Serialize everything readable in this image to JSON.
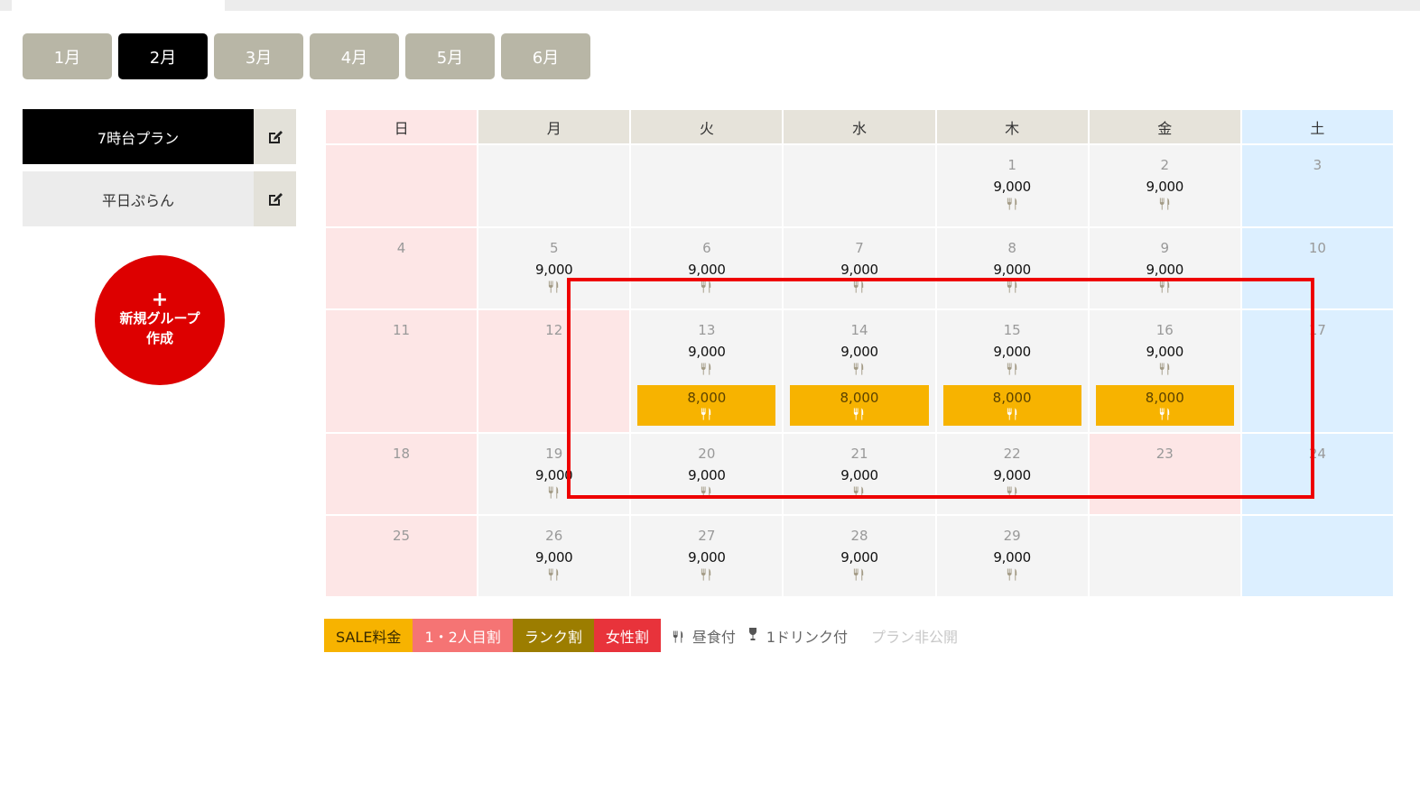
{
  "month_tabs": [
    {
      "label": "1月"
    },
    {
      "label": "2月"
    },
    {
      "label": "3月"
    },
    {
      "label": "4月"
    },
    {
      "label": "5月"
    },
    {
      "label": "6月"
    }
  ],
  "active_month": "2月",
  "plans": [
    {
      "name": "7時台プラン",
      "active": true
    },
    {
      "name": "平日ぷらん",
      "active": false
    }
  ],
  "new_group": {
    "plus": "+",
    "line1": "新規グループ",
    "line2": "作成"
  },
  "calendar": {
    "weekdays": [
      "日",
      "月",
      "火",
      "水",
      "木",
      "金",
      "土"
    ],
    "weeks": [
      [
        {
          "type": "sun",
          "day": "",
          "price": "",
          "meal": false
        },
        {
          "type": "",
          "day": "",
          "price": "",
          "meal": false
        },
        {
          "type": "",
          "day": "",
          "price": "",
          "meal": false
        },
        {
          "type": "",
          "day": "",
          "price": "",
          "meal": false
        },
        {
          "type": "",
          "day": "1",
          "price": "9,000",
          "meal": true
        },
        {
          "type": "",
          "day": "2",
          "price": "9,000",
          "meal": true
        },
        {
          "type": "sat",
          "day": "3",
          "price": "",
          "meal": false
        }
      ],
      [
        {
          "type": "sun",
          "day": "4",
          "price": "",
          "meal": false
        },
        {
          "type": "",
          "day": "5",
          "price": "9,000",
          "meal": true
        },
        {
          "type": "",
          "day": "6",
          "price": "9,000",
          "meal": true
        },
        {
          "type": "",
          "day": "7",
          "price": "9,000",
          "meal": true
        },
        {
          "type": "",
          "day": "8",
          "price": "9,000",
          "meal": true
        },
        {
          "type": "",
          "day": "9",
          "price": "9,000",
          "meal": true
        },
        {
          "type": "sat",
          "day": "10",
          "price": "",
          "meal": false
        }
      ],
      [
        {
          "type": "sun",
          "day": "11",
          "price": "",
          "meal": false
        },
        {
          "type": "hol",
          "day": "12",
          "price": "",
          "meal": false
        },
        {
          "type": "",
          "day": "13",
          "price": "9,000",
          "meal": true,
          "sale": "8,000"
        },
        {
          "type": "",
          "day": "14",
          "price": "9,000",
          "meal": true,
          "sale": "8,000"
        },
        {
          "type": "",
          "day": "15",
          "price": "9,000",
          "meal": true,
          "sale": "8,000"
        },
        {
          "type": "",
          "day": "16",
          "price": "9,000",
          "meal": true,
          "sale": "8,000"
        },
        {
          "type": "sat",
          "day": "17",
          "price": "",
          "meal": false
        }
      ],
      [
        {
          "type": "sun",
          "day": "18",
          "price": "",
          "meal": false
        },
        {
          "type": "",
          "day": "19",
          "price": "9,000",
          "meal": true
        },
        {
          "type": "",
          "day": "20",
          "price": "9,000",
          "meal": true
        },
        {
          "type": "",
          "day": "21",
          "price": "9,000",
          "meal": true
        },
        {
          "type": "",
          "day": "22",
          "price": "9,000",
          "meal": true
        },
        {
          "type": "hol",
          "day": "23",
          "price": "",
          "meal": false
        },
        {
          "type": "sat",
          "day": "24",
          "price": "",
          "meal": false
        }
      ],
      [
        {
          "type": "sun",
          "day": "25",
          "price": "",
          "meal": false
        },
        {
          "type": "",
          "day": "26",
          "price": "9,000",
          "meal": true
        },
        {
          "type": "",
          "day": "27",
          "price": "9,000",
          "meal": true
        },
        {
          "type": "",
          "day": "28",
          "price": "9,000",
          "meal": true
        },
        {
          "type": "",
          "day": "29",
          "price": "9,000",
          "meal": true
        },
        {
          "type": "",
          "day": "",
          "price": "",
          "meal": false
        },
        {
          "type": "sat",
          "day": "",
          "price": "",
          "meal": false
        }
      ]
    ]
  },
  "legend": {
    "sale": "SALE料金",
    "first_second": "1・2人目割",
    "rank": "ランク割",
    "female": "女性割",
    "lunch": "昼食付",
    "drink": "1ドリンク付",
    "private": "プラン非公開"
  },
  "colors": {
    "sale": "#f7b300",
    "first_second": "#f57474",
    "rank": "#9c7d00",
    "female": "#e8333b",
    "new_group": "#dd0000",
    "highlight": "#ee0000"
  },
  "icons": {
    "meal": "fork-knife-icon",
    "edit": "edit-icon",
    "drink": "wine-glass-icon"
  }
}
